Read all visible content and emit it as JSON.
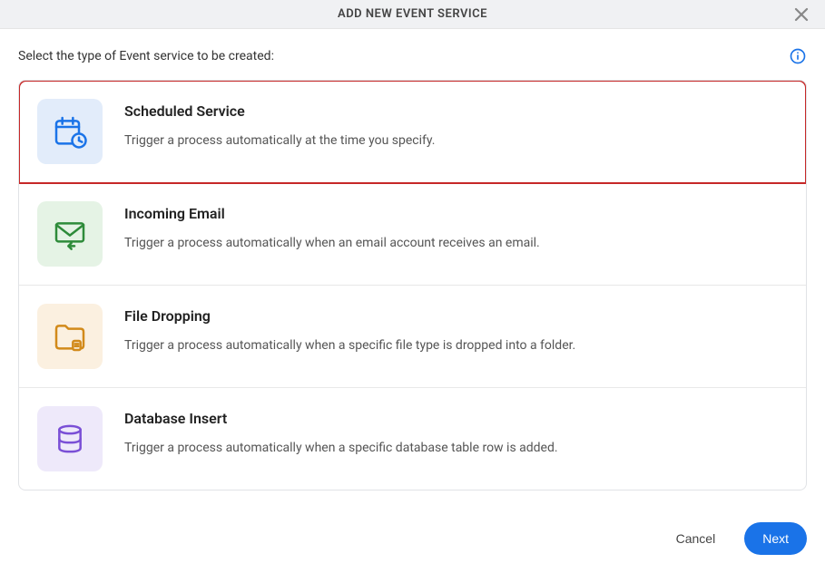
{
  "header": {
    "title": "ADD NEW EVENT SERVICE"
  },
  "prompt": "Select the type of Event service to be created:",
  "options": [
    {
      "title": "Scheduled Service",
      "desc": "Trigger a process automatically at the time you specify."
    },
    {
      "title": "Incoming Email",
      "desc": "Trigger a process automatically when an email account receives an email."
    },
    {
      "title": "File Dropping",
      "desc": "Trigger a process automatically when a specific file type is dropped into a folder."
    },
    {
      "title": "Database Insert",
      "desc": "Trigger a process automatically when a specific database table row is added."
    }
  ],
  "footer": {
    "cancel": "Cancel",
    "next": "Next"
  }
}
